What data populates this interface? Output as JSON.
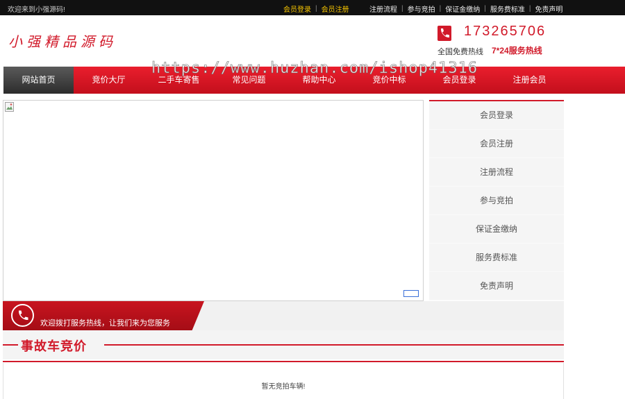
{
  "topbar": {
    "welcome": "欢迎来到小强源码!",
    "auth": [
      "会员登录",
      "会员注册"
    ],
    "links": [
      "注册流程",
      "参与竞拍",
      "保证金缴纳",
      "服务费标准",
      "免责声明"
    ]
  },
  "header": {
    "logo_text": "小强精品源码",
    "hotline_number": "173265706",
    "hotline_label": "全国免费热线",
    "hotline_label2": "7*24服务热线"
  },
  "watermark": "https://www.huzhan.com/ishop41316",
  "nav": {
    "items": [
      "网站首页",
      "竞价大厅",
      "二手车寄售",
      "常见问题",
      "帮助中心",
      "竞价中标",
      "会员登录",
      "注册会员"
    ],
    "active_index": 0
  },
  "side_menu": [
    "会员登录",
    "会员注册",
    "注册流程",
    "参与竞拍",
    "保证金缴纳",
    "服务费标准",
    "免责声明"
  ],
  "service": {
    "text": "欢迎拨打服务热线，让我们来为您服务"
  },
  "section": {
    "title": "事故车竞价",
    "empty_text": "暂无竞拍车辆!"
  },
  "colors": {
    "accent": "#d11a2a",
    "topbar": "#111111",
    "auth_link": "#f5c400"
  },
  "icons": [
    "phone-icon",
    "broken-image-icon"
  ]
}
